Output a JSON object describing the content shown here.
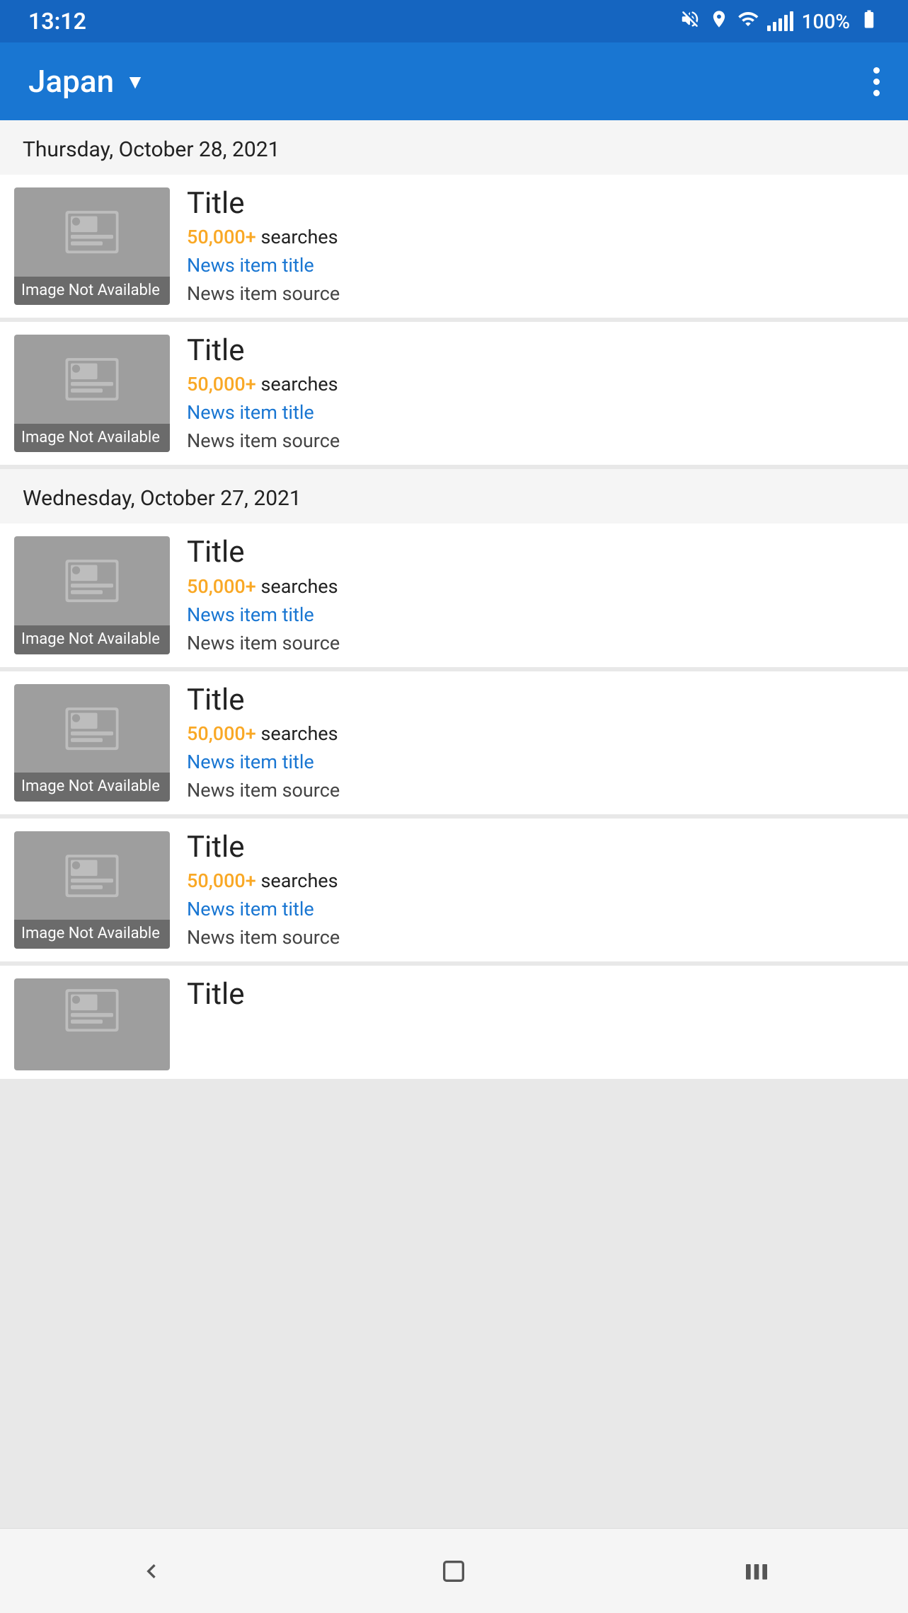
{
  "statusBar": {
    "time": "13:12",
    "battery": "100%"
  },
  "appBar": {
    "title": "Japan",
    "moreOptionsLabel": "More options"
  },
  "sections": [
    {
      "dateLabel": "Thursday, October 28, 2021",
      "cards": [
        {
          "thumbnailAlt": "Image Not Available",
          "title": "Title",
          "searches": "50,000+",
          "searchesLabel": "searches",
          "newsLink": "News item title",
          "newsSource": "News item source"
        },
        {
          "thumbnailAlt": "Image Not Available",
          "title": "Title",
          "searches": "50,000+",
          "searchesLabel": "searches",
          "newsLink": "News item title",
          "newsSource": "News item source"
        }
      ]
    },
    {
      "dateLabel": "Wednesday, October 27, 2021",
      "cards": [
        {
          "thumbnailAlt": "Image Not Available",
          "title": "Title",
          "searches": "50,000+",
          "searchesLabel": "searches",
          "newsLink": "News item title",
          "newsSource": "News item source"
        },
        {
          "thumbnailAlt": "Image Not Available",
          "title": "Title",
          "searches": "50,000+",
          "searchesLabel": "searches",
          "newsLink": "News item title",
          "newsSource": "News item source"
        },
        {
          "thumbnailAlt": "Image Not Available",
          "title": "Title",
          "searches": "50,000+",
          "searchesLabel": "searches",
          "newsLink": "News item title",
          "newsSource": "News item source"
        }
      ]
    }
  ],
  "partialCard": {
    "thumbnailAlt": "Image Not Available",
    "title": "Title"
  },
  "bottomNav": {
    "backLabel": "Back",
    "homeLabel": "Home",
    "recentLabel": "Recent Apps"
  }
}
